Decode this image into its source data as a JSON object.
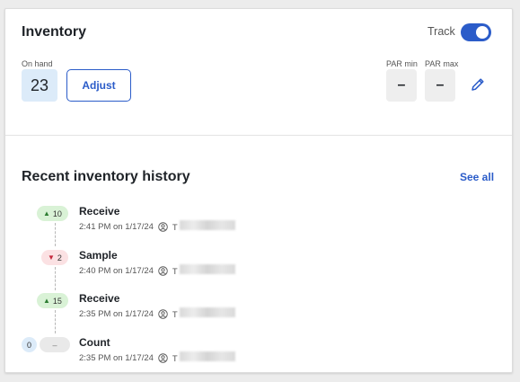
{
  "inventory": {
    "title": "Inventory",
    "track_label": "Track",
    "track_enabled": true,
    "on_hand_label": "On hand",
    "on_hand_value": "23",
    "adjust_label": "Adjust",
    "par_min_label": "PAR min",
    "par_min_value": "–",
    "par_max_label": "PAR max",
    "par_max_value": "–",
    "accent_color": "#2b5cc9"
  },
  "history": {
    "title": "Recent inventory history",
    "see_all_label": "See all",
    "entries": [
      {
        "change": "10",
        "direction": "up",
        "type": "Receive",
        "time": "2:41 PM on 1/17/24",
        "user_initial": "T"
      },
      {
        "change": "2",
        "direction": "down",
        "type": "Sample",
        "time": "2:40 PM on 1/17/24",
        "user_initial": "T"
      },
      {
        "change": "15",
        "direction": "up",
        "type": "Receive",
        "time": "2:35 PM on 1/17/24",
        "user_initial": "T"
      },
      {
        "count_value": "0",
        "change": "–",
        "direction": "neutral",
        "type": "Count",
        "time": "2:35 PM on 1/17/24",
        "user_initial": "T"
      }
    ]
  }
}
